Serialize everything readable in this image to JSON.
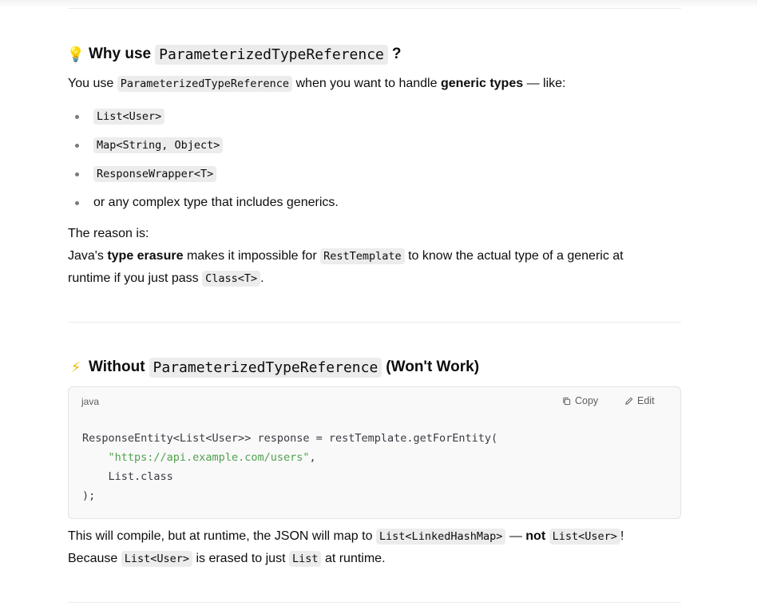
{
  "section1": {
    "emoji": "💡",
    "heading_pre": "Why use",
    "heading_code": "ParameterizedTypeReference",
    "heading_post": "?",
    "intro": {
      "t1": "You use",
      "code": "ParameterizedTypeReference",
      "t2": "when you want to handle",
      "bold": "generic types",
      "t3": "— like:"
    },
    "bullets": [
      "List<User>",
      "Map<String, Object>",
      "ResponseWrapper<T>"
    ],
    "bullet_text": "or any complex type that includes generics.",
    "reason_label": "The reason is:",
    "reason": {
      "t1": "Java's",
      "bold": "type erasure",
      "t2": "makes it impossible for",
      "code1": "RestTemplate",
      "t3": "to know the actual type of a generic at",
      "t4": "runtime if you just pass",
      "code2": "Class<T>",
      "t5": "."
    }
  },
  "section2": {
    "emoji": "⚡",
    "heading_pre": "Without",
    "heading_code": "ParameterizedTypeReference",
    "heading_post": "(Won't Work)",
    "codeblock": {
      "lang": "java",
      "copy_label": "Copy",
      "edit_label": "Edit",
      "line1": "ResponseEntity<List<User>> response = restTemplate.getForEntity(",
      "line2_indent": "    ",
      "line2_str": "\"https://api.example.com/users\"",
      "line2_tail": ",",
      "line3": "    List.class",
      "line4": ");"
    },
    "explain1": {
      "t1": "This will compile, but at runtime, the JSON will map to",
      "code1": "List<LinkedHashMap>",
      "t2": "—",
      "bold": "not",
      "code2": "List<User>",
      "t3": "!"
    },
    "explain2": {
      "t1": "Because",
      "code1": "List<User>",
      "t2": "is erased to just",
      "code2": "List",
      "t3": "at runtime."
    }
  }
}
